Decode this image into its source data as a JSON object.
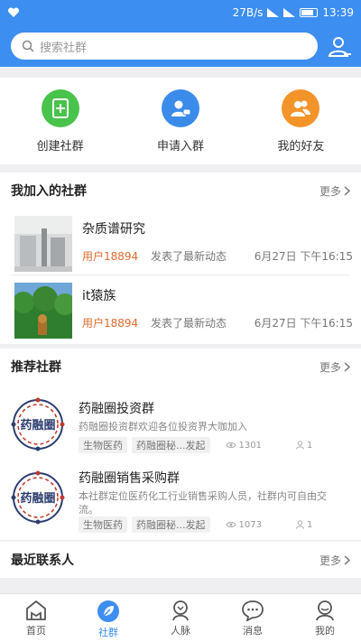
{
  "status_bar": {
    "speed": "27B/s",
    "time": "13:39"
  },
  "search": {
    "placeholder": "搜索社群"
  },
  "quick_actions": [
    {
      "label": "创建社群",
      "icon": "create-plus-icon",
      "color": "#49c34c"
    },
    {
      "label": "申请入群",
      "icon": "join-request-icon",
      "color": "#3b8bea"
    },
    {
      "label": "我的好友",
      "icon": "friends-icon",
      "color": "#f3942b"
    }
  ],
  "joined": {
    "title": "我加入的社群",
    "more": "更多",
    "items": [
      {
        "name": "杂质谱研究",
        "user": "用户18894",
        "action": "发表了最新动态",
        "time": "6月27日 下午16:15"
      },
      {
        "name": "it猿族",
        "user": "用户18894",
        "action": "发表了最新动态",
        "time": "6月27日 下午16:15"
      }
    ]
  },
  "recommended": {
    "title": "推荐社群",
    "more": "更多",
    "logo_text": "药融圈",
    "items": [
      {
        "name": "药融圈投资群",
        "desc": "药融圈投资群欢迎各位投资界大咖加入",
        "tag": "生物医药",
        "author": "药融圈秘...发起",
        "views": "1301",
        "members": "1"
      },
      {
        "name": "药融圈销售采购群",
        "desc": "本社群定位医药化工行业销售采购人员，社群内可自由交流。",
        "tag": "生物医药",
        "author": "药融圈秘...发起",
        "views": "1073",
        "members": "1"
      }
    ]
  },
  "contacts": {
    "title": "最近联系人",
    "more": "更多"
  },
  "tabs": [
    {
      "label": "首页",
      "icon": "home-icon"
    },
    {
      "label": "社群",
      "icon": "community-icon"
    },
    {
      "label": "人脉",
      "icon": "connections-icon"
    },
    {
      "label": "消息",
      "icon": "message-icon"
    },
    {
      "label": "我的",
      "icon": "profile-icon"
    }
  ],
  "active_tab": "社群",
  "colors": {
    "primary": "#3c8ef0",
    "highlight": "#e06a2c",
    "logo_red": "#c0392b",
    "logo_navy": "#2c3e70"
  }
}
